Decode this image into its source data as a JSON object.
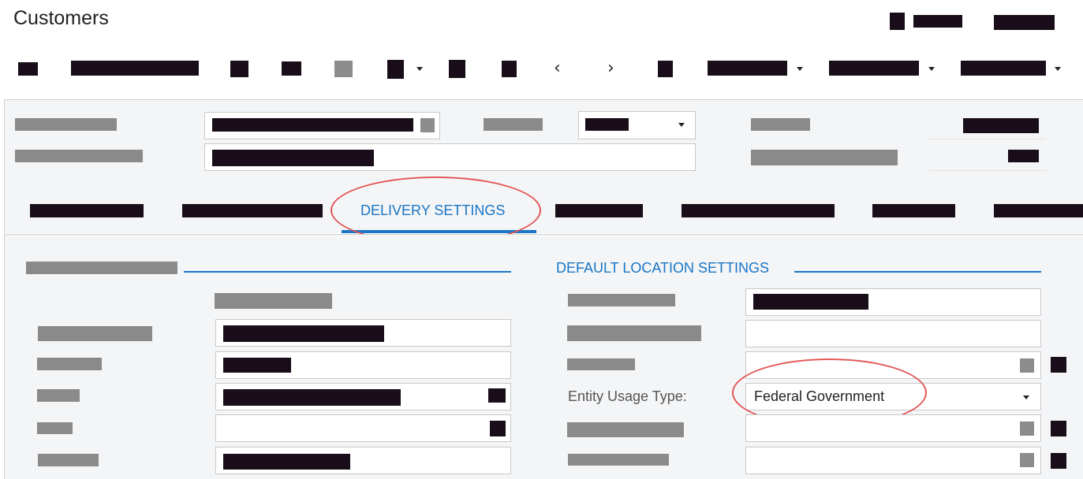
{
  "page": {
    "title": "Customers"
  },
  "tabs": {
    "active_label": "DELIVERY SETTINGS"
  },
  "default_location_settings": {
    "title": "DEFAULT LOCATION SETTINGS",
    "entity_usage_type": {
      "label": "Entity Usage Type:",
      "value": "Federal Government"
    }
  },
  "toolbar": {
    "prev_icon": "chevron-left-icon",
    "next_icon": "chevron-right-icon"
  },
  "colors": {
    "accent": "#1976c5",
    "highlight": "#e35555",
    "redaction": "#190d19",
    "panel_background": "#f4f5f7"
  }
}
